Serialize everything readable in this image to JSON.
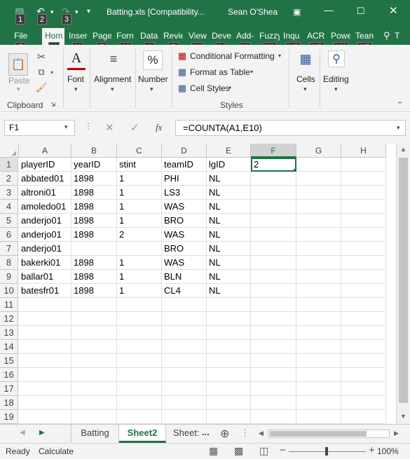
{
  "window": {
    "title": "Batting.xls  [Compatibility...",
    "user": "Sean O'Shea",
    "qat_keytips": [
      "1",
      "2",
      "3"
    ]
  },
  "ribbon_tabs": [
    {
      "label": "File",
      "keytip": "F"
    },
    {
      "label": "Hom",
      "keytip": "H"
    },
    {
      "label": "Inser",
      "keytip": "N"
    },
    {
      "label": "Page",
      "keytip": "P"
    },
    {
      "label": "Forn",
      "keytip": "M"
    },
    {
      "label": "Data",
      "keytip": "A"
    },
    {
      "label": "Revie",
      "keytip": "R"
    },
    {
      "label": "View",
      "keytip": "W"
    },
    {
      "label": "Deve",
      "keytip": "L"
    },
    {
      "label": "Add-",
      "keytip": "X"
    },
    {
      "label": "Fuzzy",
      "keytip": "Y1"
    },
    {
      "label": "Inqu",
      "keytip": "Y2"
    },
    {
      "label": "ACR",
      "keytip": "Y3"
    },
    {
      "label": "Powe",
      "keytip": "Y4"
    },
    {
      "label": "Tean",
      "keytip": "Y5"
    },
    {
      "label": "T",
      "keytip": ""
    }
  ],
  "ribbon": {
    "paste": "Paste",
    "clipboard": "Clipboard",
    "font": "Font",
    "alignment": "Alignment",
    "number": "Number",
    "number_symbol": "%",
    "conditional_formatting": "Conditional Formatting",
    "format_as_table": "Format as Table",
    "cell_styles": "Cell Styles",
    "styles": "Styles",
    "cells": "Cells",
    "editing": "Editing"
  },
  "formula_bar": {
    "name_box": "F1",
    "fx": "fx",
    "formula": "=COUNTA(A1,E10)"
  },
  "grid": {
    "columns": [
      "A",
      "B",
      "C",
      "D",
      "E",
      "F",
      "G",
      "H"
    ],
    "selected_column": "F",
    "row_numbers": [
      "1",
      "2",
      "3",
      "4",
      "5",
      "6",
      "7",
      "8",
      "9",
      "10",
      "11",
      "12",
      "13",
      "14",
      "15",
      "16",
      "17",
      "18",
      "19"
    ],
    "rows": [
      [
        "playerID",
        "yearID",
        "stint",
        "teamID",
        "lgID",
        "2"
      ],
      [
        "abbated01",
        "1898",
        "1",
        "PHI",
        "NL",
        ""
      ],
      [
        "altroni01",
        "1898",
        "1",
        "LS3",
        "NL",
        ""
      ],
      [
        "amoledo01",
        "1898",
        "1",
        "WAS",
        "NL",
        ""
      ],
      [
        "anderjo01",
        "1898",
        "1",
        "BRO",
        "NL",
        ""
      ],
      [
        "anderjo01",
        "1898",
        "2",
        "WAS",
        "NL",
        ""
      ],
      [
        "anderjo01",
        "",
        "",
        "BRO",
        "NL",
        ""
      ],
      [
        "bakerki01",
        "1898",
        "1",
        "WAS",
        "NL",
        ""
      ],
      [
        "ballar01",
        "1898",
        "1",
        "BLN",
        "NL",
        ""
      ],
      [
        "batesfr01",
        "1898",
        "1",
        "CL4",
        "NL",
        ""
      ]
    ]
  },
  "sheets": [
    {
      "label": "Batting",
      "active": false
    },
    {
      "label": "Sheet2",
      "active": true
    },
    {
      "label": "Sheet:",
      "active": false
    }
  ],
  "sheet_more": "...",
  "status": {
    "ready": "Ready",
    "calculate": "Calculate",
    "zoom": "100%"
  },
  "colors": {
    "accent": "#217346",
    "selection": "#217346"
  }
}
